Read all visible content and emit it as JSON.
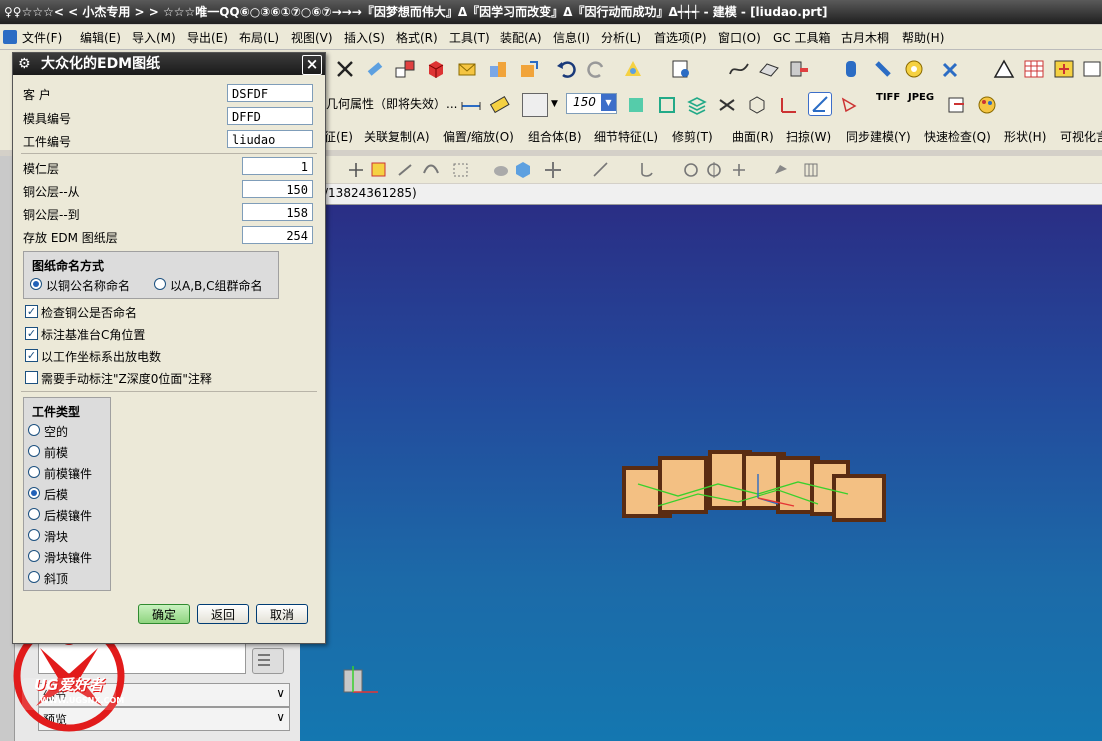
{
  "window": {
    "title": "♀♀☆☆☆< < 小杰专用 > > ☆☆☆唯一QQ⑥○③⑥①⑦○⑥⑦→→→『因梦想而伟大』Δ『因学习而改变』Δ『因行动而成功』Δ┽┽┽ - 建模 - [liudao.prt]"
  },
  "menubar": {
    "items": [
      "文件(F)",
      "编辑(E)",
      "导入(M)",
      "导出(E)",
      "布局(L)",
      "视图(V)",
      "插入(S)",
      "格式(R)",
      "工具(T)",
      "装配(A)",
      "信息(I)",
      "分析(L)",
      "首选项(P)",
      "窗口(O)",
      "GC 工具箱",
      "古月木桐",
      "帮助(H)"
    ]
  },
  "toolbar": {
    "geometry_property_label": "几何属性（即将失效）...",
    "scale_value": "150",
    "tiff_label": "TIFF",
    "jpeg_label": "JPEG"
  },
  "feature_menu": {
    "items": [
      "征(E)",
      "关联复制(A)",
      "偏置/缩放(O)",
      "组合体(B)",
      "细节特征(L)",
      "修剪(T)",
      "曲面(R)",
      "扫掠(W)",
      "同步建模(Y)",
      "快速检查(Q)",
      "形状(H)",
      "可视化言"
    ]
  },
  "viewport": {
    "header_text": "/13824361285)"
  },
  "dialog": {
    "title": "大众化的EDM图纸",
    "close_glyph": "×",
    "fields": [
      {
        "label": "客 户",
        "value": "DSFDF"
      },
      {
        "label": "模具编号",
        "value": "DFFD"
      },
      {
        "label": "工件编号",
        "value": "liudao"
      }
    ],
    "layers": [
      {
        "label": "模仁层",
        "value": "1"
      },
      {
        "label": "铜公层--从",
        "value": "150"
      },
      {
        "label": "铜公层--到",
        "value": "158"
      },
      {
        "label": "存放 EDM 图纸层",
        "value": "254"
      }
    ],
    "naming": {
      "title": "图纸命名方式",
      "options": [
        "以铜公名称命名",
        "以A,B,C组群命名"
      ],
      "selected": 0
    },
    "checks": [
      {
        "label": "检查铜公是否命名",
        "checked": true
      },
      {
        "label": "标注基准台C角位置",
        "checked": true
      },
      {
        "label": "以工作坐标系出放电数",
        "checked": true
      },
      {
        "label": "需要手动标注\"Z深度0位面\"注释",
        "checked": false
      }
    ],
    "workpiece": {
      "title": "工件类型",
      "options": [
        "空的",
        "前模",
        "前模镶件",
        "后模",
        "后模镶件",
        "滑块",
        "滑块镶件",
        "斜顶"
      ],
      "selected": 3
    },
    "buttons": {
      "ok": "确定",
      "back": "返回",
      "cancel": "取消"
    }
  },
  "watermark": {
    "brand": "UG爱好者",
    "url": "WWW.UGSNX.COM"
  },
  "bottom_panel": {
    "row1": "细节",
    "row2": "预览"
  },
  "colors": {
    "accent": "#2161b8",
    "viewport_top": "#2a2e85",
    "viewport_bottom": "#1477b0",
    "part": "#f3c083"
  }
}
